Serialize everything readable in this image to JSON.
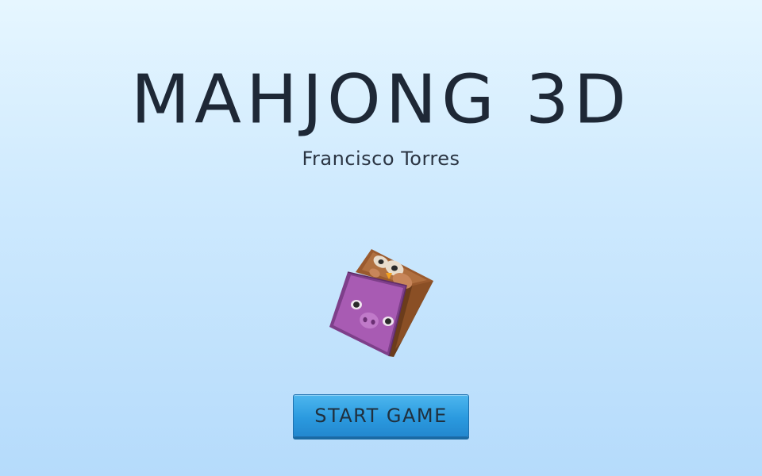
{
  "game": {
    "title": "MAHJONG 3D",
    "author": "Francisco Torres"
  },
  "menu": {
    "start_label": "START GAME"
  },
  "cube": {
    "top_face": "owl",
    "front_face": "pig",
    "side_face": "wood"
  },
  "colors": {
    "title_text": "#1e2836",
    "button_fill": "#2b9adf",
    "pig_face": "#a85bb3",
    "owl_face": "#9a5a2e"
  }
}
